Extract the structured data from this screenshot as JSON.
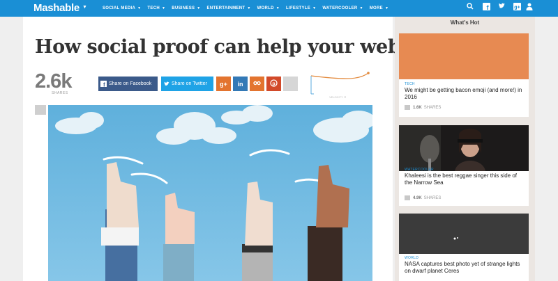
{
  "nav": {
    "logo": "Mashable",
    "items": [
      {
        "label": "SOCIAL MEDIA"
      },
      {
        "label": "TECH"
      },
      {
        "label": "BUSINESS"
      },
      {
        "label": "ENTERTAINMENT"
      },
      {
        "label": "WORLD"
      },
      {
        "label": "LIFESTYLE"
      },
      {
        "label": "WATERCOOLER"
      },
      {
        "label": "MORE"
      }
    ],
    "icons": [
      "search-icon",
      "facebook-icon",
      "twitter-icon",
      "google-plus-icon",
      "user-icon"
    ]
  },
  "article": {
    "headline": "How social proof can help your website",
    "share_count": "2.6k",
    "share_label": "SHARES",
    "share_facebook": "Share on Facebook",
    "share_twitter": "Share on Twitter",
    "velocity_label": "VELOCITY ▼"
  },
  "sidebar": {
    "title": "What's Hot",
    "cards": [
      {
        "tag": "TECH",
        "title": "We might be getting bacon emoji (and more!) in 2016",
        "shares": "1.6K",
        "shares_label": "SHARES",
        "image_color": "#e78a52"
      },
      {
        "tag": "WATERCOOLER",
        "title": "Khaleesi is the best reggae singer this side of the Narrow Sea",
        "shares": "4.9K",
        "shares_label": "SHARES"
      },
      {
        "tag": "WORLD",
        "title": "NASA captures best photo yet of strange lights on dwarf planet Ceres"
      }
    ]
  },
  "colors": {
    "brand_blue": "#1a8fd5",
    "facebook": "#3b5a8a",
    "twitter": "#1fa3e6",
    "google_plus": "#e3742f",
    "linkedin": "#3379b6",
    "pinterest": "#d24a2a"
  }
}
